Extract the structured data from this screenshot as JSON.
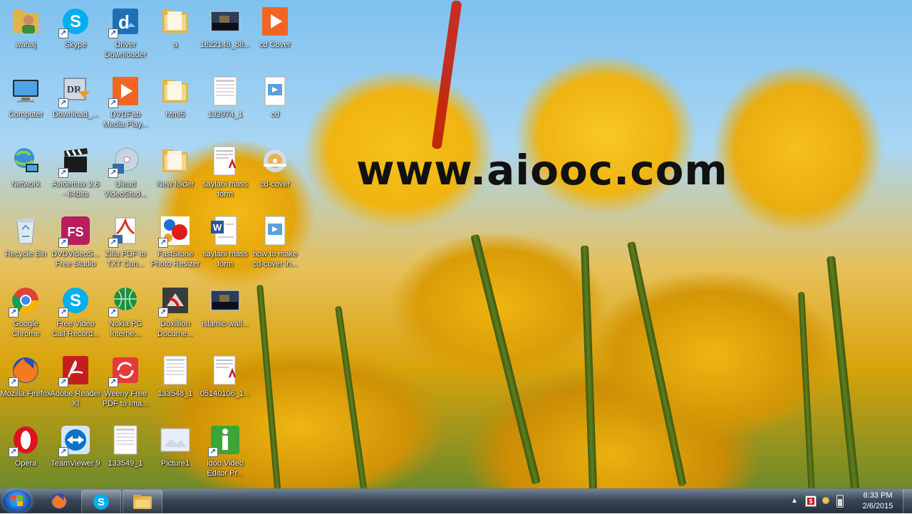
{
  "watermark": "www.aiooc.com",
  "icons": [
    {
      "label": "wahaj",
      "icon": "user-folder-icon"
    },
    {
      "label": "Computer",
      "icon": "computer-icon"
    },
    {
      "label": "Network",
      "icon": "network-icon"
    },
    {
      "label": "Recycle Bin",
      "icon": "recycle-bin-icon"
    },
    {
      "label": "Google Chrome",
      "icon": "chrome-icon"
    },
    {
      "label": "Mozilla Firefox",
      "icon": "firefox-icon"
    },
    {
      "label": "Opera",
      "icon": "opera-icon"
    },
    {
      "label": "Skype",
      "icon": "skype-icon"
    },
    {
      "label": "Download_...",
      "icon": "download-icon"
    },
    {
      "label": "Avidemux 2.6 - 64bits",
      "icon": "clapperboard-icon"
    },
    {
      "label": "DVDVideoS... Free Studio",
      "icon": "fs-icon"
    },
    {
      "label": "Free Video Call Record...",
      "icon": "skype-icon"
    },
    {
      "label": "Adobe Reader XI",
      "icon": "adobe-reader-icon"
    },
    {
      "label": "TeamViewer 9",
      "icon": "teamviewer-icon"
    },
    {
      "label": "Driver Downloader",
      "icon": "driver-downloader-icon"
    },
    {
      "label": "DVDFab Media Play...",
      "icon": "play-icon"
    },
    {
      "label": "Ulead VideoStud...",
      "icon": "disc-icon"
    },
    {
      "label": "Zilla PDF to TXT Con...",
      "icon": "pdf-convert-icon"
    },
    {
      "label": "Nokia PC Interne...",
      "icon": "globe-icon"
    },
    {
      "label": "Weeny Free PDF to Ima...",
      "icon": "pdf-image-icon"
    },
    {
      "label": "133549_1",
      "icon": "image-file-icon"
    },
    {
      "label": "a",
      "icon": "folder-icon"
    },
    {
      "label": "html5",
      "icon": "folder-icon"
    },
    {
      "label": "New folder",
      "icon": "folder-icon"
    },
    {
      "label": "FastStone Photo Resizer",
      "icon": "faststone-icon"
    },
    {
      "label": "Doxillion Docume...",
      "icon": "doxillion-icon"
    },
    {
      "label": "133548_1",
      "icon": "image-file-icon"
    },
    {
      "label": "Picture1",
      "icon": "picture-file-icon"
    },
    {
      "label": "1622148_68...",
      "icon": "photo-file-icon"
    },
    {
      "label": "132974_1",
      "icon": "image-file-icon"
    },
    {
      "label": "saylani mass form",
      "icon": "pdf-file-icon"
    },
    {
      "label": "saylani mass form",
      "icon": "word-file-icon"
    },
    {
      "label": "islamic-wall...",
      "icon": "photo-file-icon"
    },
    {
      "label": "05140106_1...",
      "icon": "pdf-file-icon"
    },
    {
      "label": "idoo Video Editor Pr...",
      "icon": "idoo-icon"
    },
    {
      "label": "cd Cover",
      "icon": "play-icon"
    },
    {
      "label": "cd",
      "icon": "media-file-icon"
    },
    {
      "label": "cd-cover",
      "icon": "cd-cover-icon"
    },
    {
      "label": "how to make cd-cover in...",
      "icon": "media-file-icon"
    }
  ],
  "taskbar": {
    "apps": [
      {
        "name": "firefox",
        "icon": "firefox-icon"
      },
      {
        "name": "skype",
        "icon": "skype-icon"
      },
      {
        "name": "explorer",
        "icon": "folder-icon"
      }
    ],
    "clock": {
      "time": "6:33 PM",
      "date": "2/6/2015"
    }
  }
}
